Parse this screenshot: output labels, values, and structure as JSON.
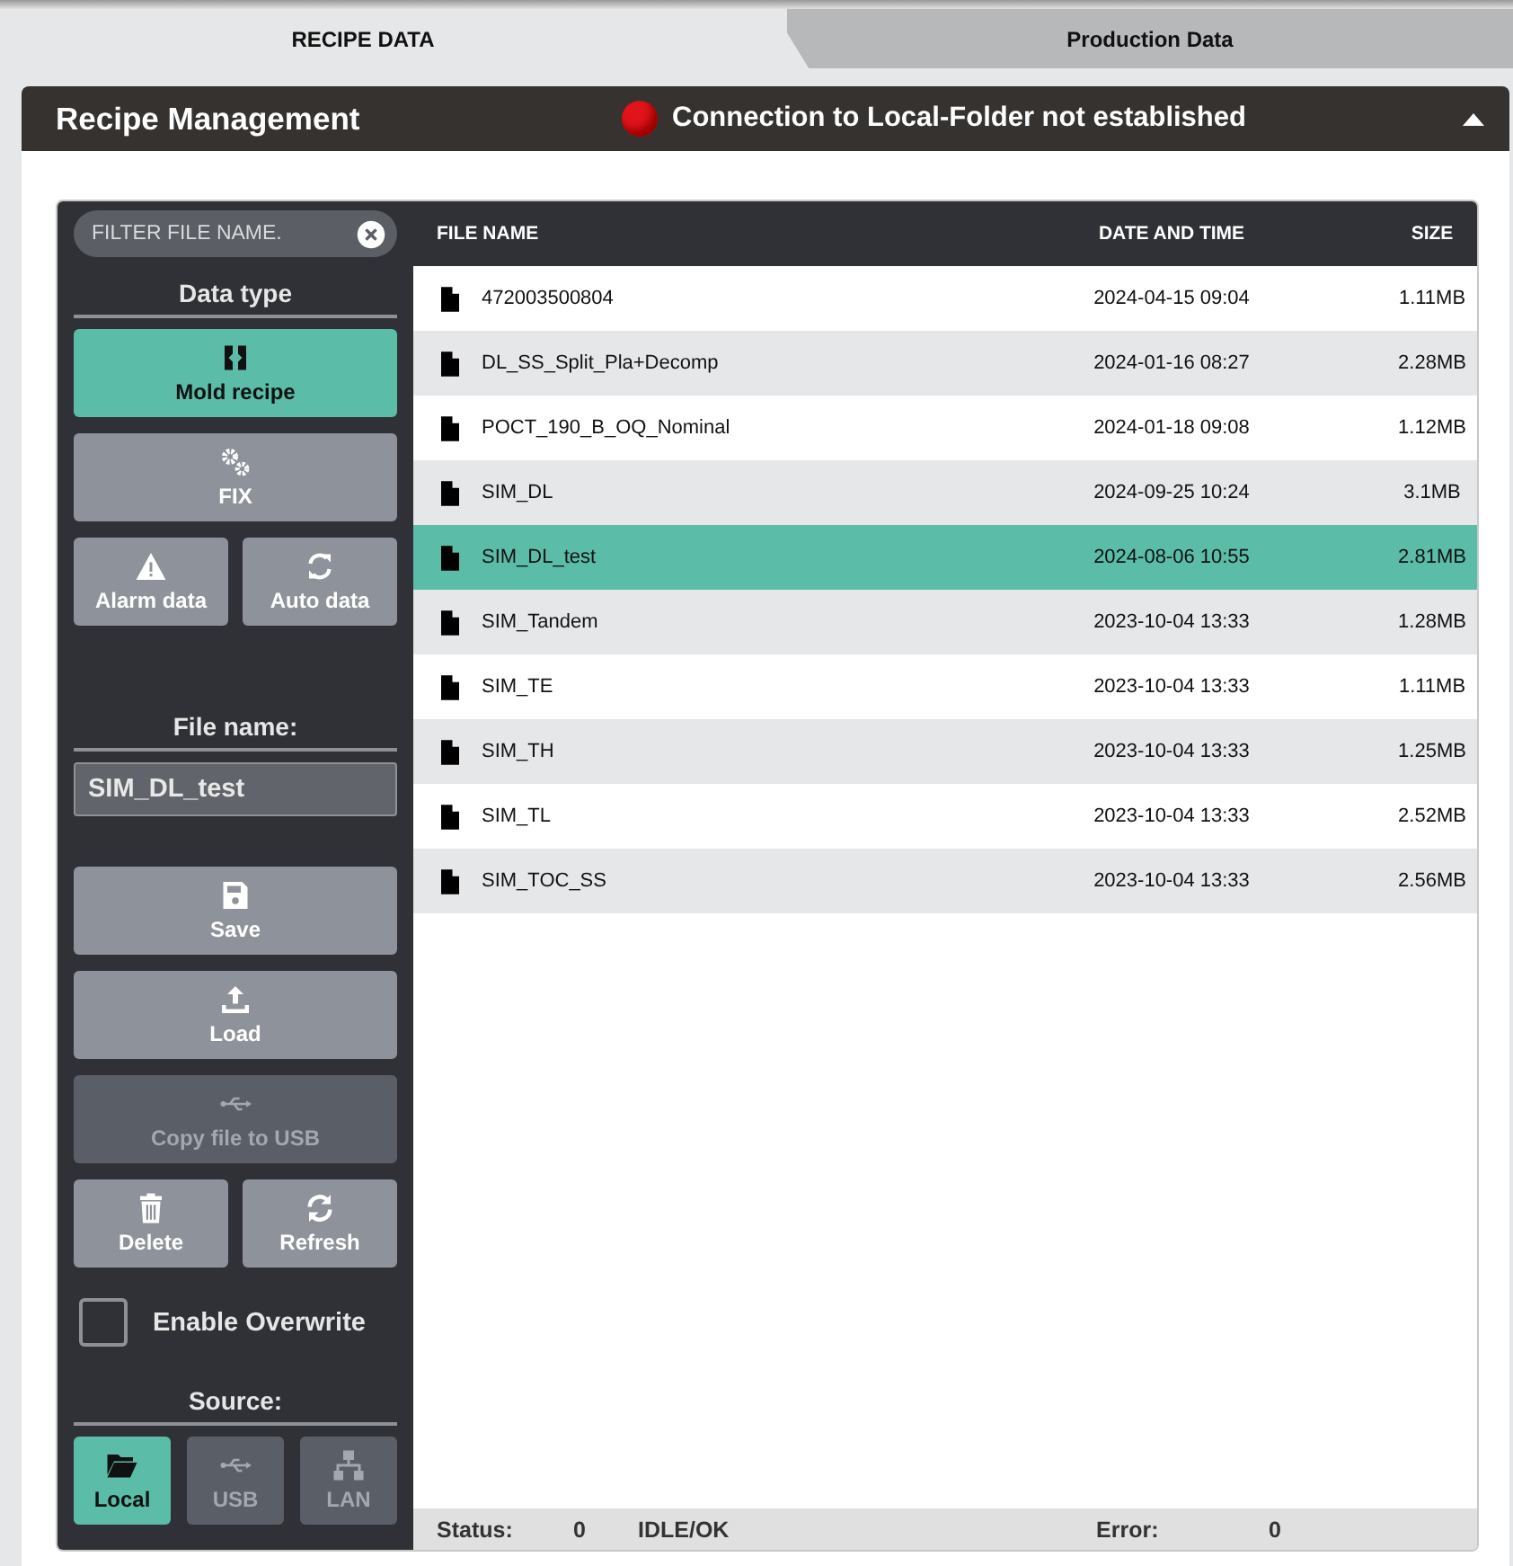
{
  "tabs": [
    {
      "label": "RECIPE DATA",
      "selected": true
    },
    {
      "label": "Production Data",
      "selected": false
    }
  ],
  "panel": {
    "title": "Recipe Management",
    "connection": {
      "text": "Connection to Local-Folder not established",
      "connected": false
    },
    "expanded": true
  },
  "sidebar": {
    "filter": {
      "placeholder": "FILTER FILE NAME."
    },
    "data_type": {
      "title": "Data type",
      "buttons": [
        {
          "label": "Mold recipe",
          "selected": true
        },
        {
          "label": "FIX",
          "selected": false
        },
        {
          "label": "Alarm data",
          "selected": false
        },
        {
          "label": "Auto data",
          "selected": false
        }
      ]
    },
    "file_name": {
      "label": "File name:",
      "value": "SIM_DL_test"
    },
    "actions": [
      {
        "label": "Save",
        "disabled": false
      },
      {
        "label": "Load",
        "disabled": false
      },
      {
        "label": "Copy file to USB",
        "disabled": true
      },
      {
        "label": "Delete",
        "disabled": false
      },
      {
        "label": "Refresh",
        "disabled": false
      }
    ],
    "overwrite": {
      "label": "Enable Overwrite",
      "checked": false
    },
    "source": {
      "title": "Source:",
      "buttons": [
        {
          "label": "Local",
          "selected": true,
          "disabled": false
        },
        {
          "label": "USB",
          "selected": false,
          "disabled": true
        },
        {
          "label": "LAN",
          "selected": false,
          "disabled": true
        }
      ]
    }
  },
  "table": {
    "columns": [
      "FILE NAME",
      "DATE AND TIME",
      "SIZE"
    ],
    "rows": [
      {
        "name": "472003500804",
        "date": "2024-04-15 09:04",
        "size": "1.11MB",
        "selected": false
      },
      {
        "name": "DL_SS_Split_Pla+Decomp",
        "date": "2024-01-16 08:27",
        "size": "2.28MB",
        "selected": false
      },
      {
        "name": "POCT_190_B_OQ_Nominal",
        "date": "2024-01-18 09:08",
        "size": "1.12MB",
        "selected": false
      },
      {
        "name": "SIM_DL",
        "date": "2024-09-25 10:24",
        "size": "3.1MB",
        "selected": false
      },
      {
        "name": "SIM_DL_test",
        "date": "2024-08-06 10:55",
        "size": "2.81MB",
        "selected": true
      },
      {
        "name": "SIM_Tandem",
        "date": "2023-10-04 13:33",
        "size": "1.28MB",
        "selected": false
      },
      {
        "name": "SIM_TE",
        "date": "2023-10-04 13:33",
        "size": "1.11MB",
        "selected": false
      },
      {
        "name": "SIM_TH",
        "date": "2023-10-04 13:33",
        "size": "1.25MB",
        "selected": false
      },
      {
        "name": "SIM_TL",
        "date": "2023-10-04 13:33",
        "size": "2.52MB",
        "selected": false
      },
      {
        "name": "SIM_TOC_SS",
        "date": "2023-10-04 13:33",
        "size": "2.56MB",
        "selected": false
      }
    ]
  },
  "status_bar": {
    "status_label": "Status:",
    "status_code": "0",
    "status_text": "IDLE/OK",
    "error_label": "Error:",
    "error_code": "0"
  }
}
